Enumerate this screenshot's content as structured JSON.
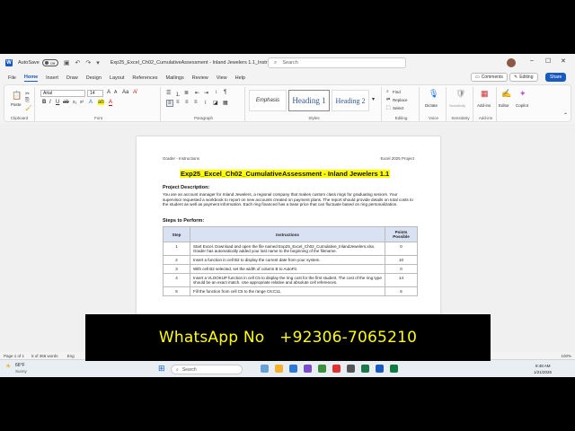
{
  "titlebar": {
    "autosave_label": "AutoSave",
    "autosave_state": "Off",
    "doc_title": "Exp25_Excel_Ch02_CumulativeAssessment - Inland Jewelers 1.1_Instruct...",
    "search_placeholder": "Search"
  },
  "menu": {
    "tabs": [
      "File",
      "Home",
      "Insert",
      "Draw",
      "Design",
      "Layout",
      "References",
      "Mailings",
      "Review",
      "View",
      "Help"
    ],
    "comments_label": "Comments",
    "editing_label": "Editing",
    "share_label": "Share"
  },
  "ribbon": {
    "font_name": "Arial",
    "font_size": "14",
    "groups": {
      "clipboard": "Clipboard",
      "font": "Font",
      "paragraph": "Paragraph",
      "styles": "Styles",
      "editing": "Editing",
      "voice": "Voice",
      "sensitivity": "Sensitivity",
      "addins": "Add-ins"
    },
    "paste_label": "Paste",
    "styles": [
      "Emphasis",
      "Heading 1",
      "Heading 2"
    ],
    "find_label": "Find",
    "replace_label": "Replace",
    "select_label": "Select",
    "dictate_label": "Dictate",
    "sensitivity_label": "Sensitivity",
    "addins_label": "Add-ins",
    "editor_label": "Editor",
    "copilot_label": "Copilot"
  },
  "document": {
    "header_left": "Grader - Instructions",
    "header_right": "Excel 2025 Project",
    "title": "Exp25_Excel_Ch02_CumulativeAssessment - Inland Jewelers 1.1",
    "project_heading": "Project Description:",
    "project_text": "You are an account manager for Inland Jewelers, a regional company that makes custom class rings for graduating seniors. Your supervisor requested a workbook to report on new accounts created on payment plans. The report should provide details on total costs to the student as well as payment information. Each ring financed has a base price that can fluctuate based on ring personalization.",
    "steps_heading": "Steps to Perform:",
    "table_headers": [
      "Step",
      "Instructions",
      "Points Possible"
    ],
    "rows": [
      {
        "step": "1",
        "instructions": "Start Excel. Download and open the file named Exp25_Excel_Ch02_Cumulative_InlandJewelers.xlsx. Grader has automatically added your last name to the beginning of the filename.",
        "points": "0"
      },
      {
        "step": "2",
        "instructions": "Insert a function in cell B2 to display the current date from your system.",
        "points": "10"
      },
      {
        "step": "3",
        "instructions": "With cell B2 selected, set the width of column B to AutoFit.",
        "points": "0"
      },
      {
        "step": "4",
        "instructions": "Insert a VLOOKUP function in cell C5 to display the ring cost for the first student. The cost of the ring type should be an exact match. Use appropriate relative and absolute cell references.",
        "points": "14"
      },
      {
        "step": "5",
        "instructions": "Fill the function from cell C5 to the range C6:C11.",
        "points": "6"
      }
    ]
  },
  "status": {
    "page": "Page 1 of 1",
    "words": "5 of 366 words",
    "lang": "Eng",
    "zoom": "100%"
  },
  "taskbar": {
    "weather_temp": "66°F",
    "weather_desc": "Sunny",
    "search_label": "Search",
    "time": "8:48 AM",
    "date": "1/21/2026"
  },
  "banner": {
    "text": "WhatsApp No   +92306-7065210"
  }
}
